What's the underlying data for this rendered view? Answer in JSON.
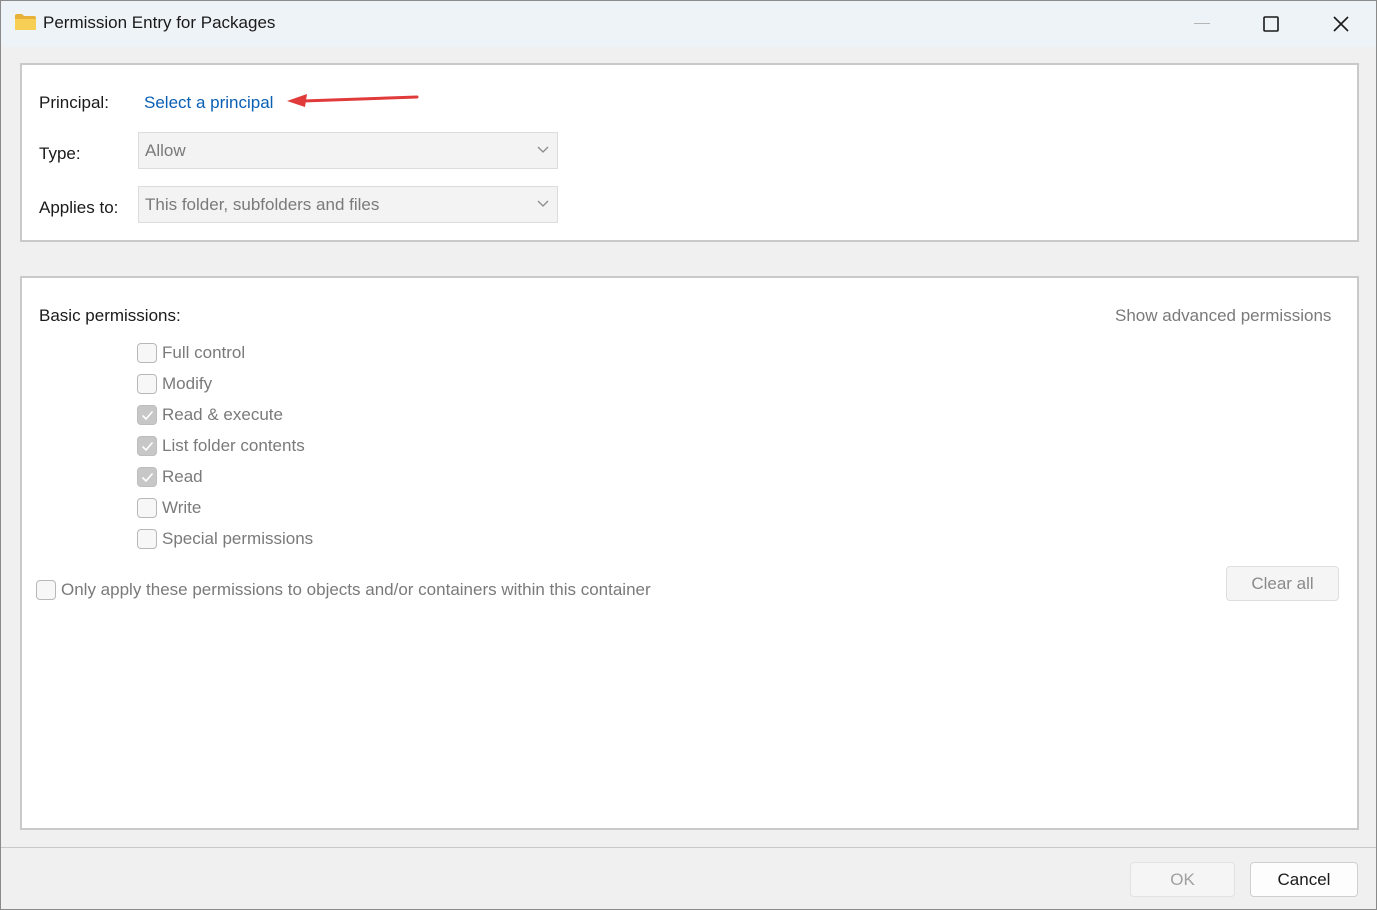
{
  "window": {
    "title": "Permission Entry for Packages",
    "title_icon": "folder-icon"
  },
  "principal": {
    "label": "Principal:",
    "link": "Select a principal"
  },
  "type": {
    "label": "Type:",
    "value": "Allow"
  },
  "applies_to": {
    "label": "Applies to:",
    "value": "This folder, subfolders and files"
  },
  "permissions": {
    "heading": "Basic permissions:",
    "advanced_link": "Show advanced permissions",
    "items": [
      {
        "label": "Full control",
        "checked": false
      },
      {
        "label": "Modify",
        "checked": false
      },
      {
        "label": "Read & execute",
        "checked": true
      },
      {
        "label": "List folder contents",
        "checked": true
      },
      {
        "label": "Read",
        "checked": true
      },
      {
        "label": "Write",
        "checked": false
      },
      {
        "label": "Special permissions",
        "checked": false
      }
    ],
    "only_apply_label": "Only apply these permissions to objects and/or containers within this container",
    "only_apply_checked": false,
    "clear_all": "Clear all"
  },
  "footer": {
    "ok": "OK",
    "cancel": "Cancel"
  },
  "colors": {
    "link": "#0a5fb4",
    "annotation_arrow": "#e03a3a"
  }
}
